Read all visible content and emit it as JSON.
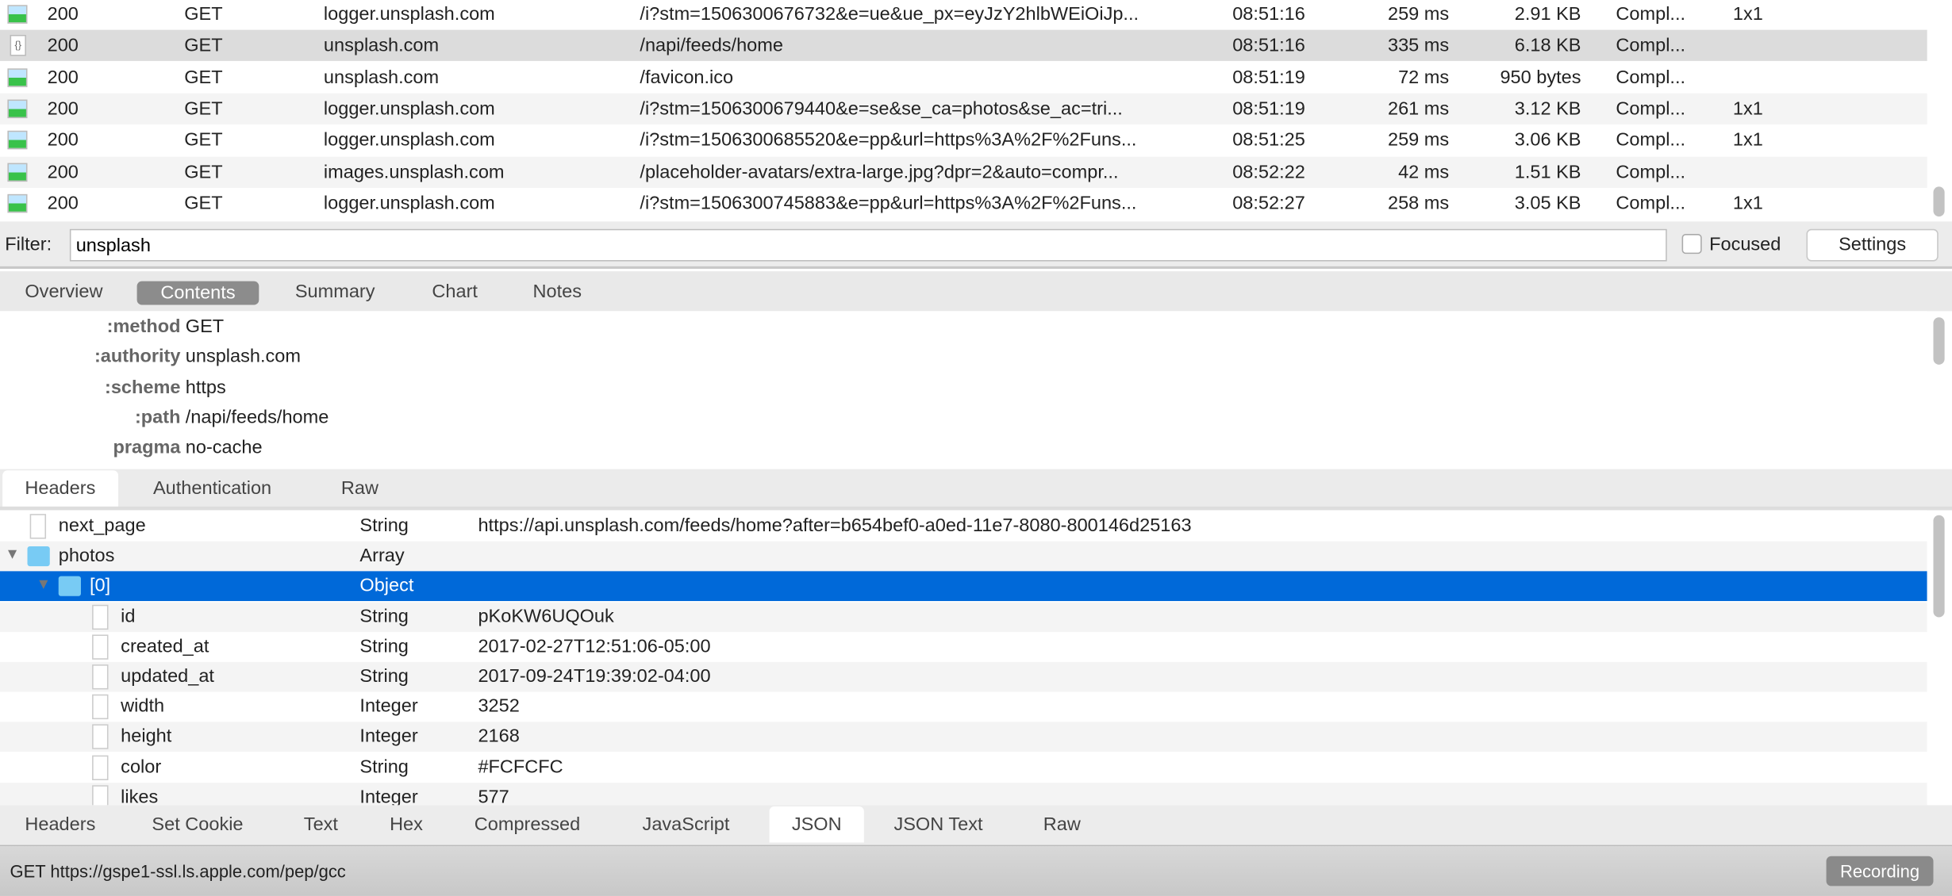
{
  "requests": {
    "selected_index": 1,
    "rows": [
      {
        "icon": "image-icon",
        "code": "200",
        "method": "GET",
        "host": "logger.unsplash.com",
        "path": "/i?stm=1506300676732&e=ue&ue_px=eyJzY2hlbWEiOiJp...",
        "time": "08:51:16",
        "duration": "259 ms",
        "size": "2.91 KB",
        "status": "Compl...",
        "dims": "1x1"
      },
      {
        "icon": "json-file-icon",
        "code": "200",
        "method": "GET",
        "host": "unsplash.com",
        "path": "/napi/feeds/home",
        "time": "08:51:16",
        "duration": "335 ms",
        "size": "6.18 KB",
        "status": "Compl...",
        "dims": ""
      },
      {
        "icon": "image-icon",
        "code": "200",
        "method": "GET",
        "host": "unsplash.com",
        "path": "/favicon.ico",
        "time": "08:51:19",
        "duration": "72 ms",
        "size": "950 bytes",
        "status": "Compl...",
        "dims": ""
      },
      {
        "icon": "image-icon",
        "code": "200",
        "method": "GET",
        "host": "logger.unsplash.com",
        "path": "/i?stm=1506300679440&e=se&se_ca=photos&se_ac=tri...",
        "time": "08:51:19",
        "duration": "261 ms",
        "size": "3.12 KB",
        "status": "Compl...",
        "dims": "1x1"
      },
      {
        "icon": "image-icon",
        "code": "200",
        "method": "GET",
        "host": "logger.unsplash.com",
        "path": "/i?stm=1506300685520&e=pp&url=https%3A%2F%2Funs...",
        "time": "08:51:25",
        "duration": "259 ms",
        "size": "3.06 KB",
        "status": "Compl...",
        "dims": "1x1"
      },
      {
        "icon": "image-icon",
        "code": "200",
        "method": "GET",
        "host": "images.unsplash.com",
        "path": "/placeholder-avatars/extra-large.jpg?dpr=2&auto=compr...",
        "time": "08:52:22",
        "duration": "42 ms",
        "size": "1.51 KB",
        "status": "Compl...",
        "dims": ""
      },
      {
        "icon": "image-icon",
        "code": "200",
        "method": "GET",
        "host": "logger.unsplash.com",
        "path": "/i?stm=1506300745883&e=pp&url=https%3A%2F%2Funs...",
        "time": "08:52:27",
        "duration": "258 ms",
        "size": "3.05 KB",
        "status": "Compl...",
        "dims": "1x1"
      }
    ]
  },
  "filter": {
    "label": "Filter:",
    "value": "unsplash",
    "focused_label": "Focused",
    "focused_checked": false,
    "settings_label": "Settings"
  },
  "main_tabs": {
    "active": "Contents",
    "items": [
      "Overview",
      "Contents",
      "Summary",
      "Chart",
      "Notes"
    ]
  },
  "request_headers": [
    {
      "key": ":method",
      "value": "GET"
    },
    {
      "key": ":authority",
      "value": "unsplash.com"
    },
    {
      "key": ":scheme",
      "value": "https"
    },
    {
      "key": ":path",
      "value": "/napi/feeds/home"
    },
    {
      "key": "pragma",
      "value": "no-cache"
    }
  ],
  "request_tabs": {
    "active": "Headers",
    "items": [
      "Headers",
      "Authentication",
      "Raw"
    ]
  },
  "json_tree": [
    {
      "depth": 0,
      "kind": "file",
      "expanded": null,
      "name": "next_page",
      "type": "String",
      "value": "https://api.unsplash.com/feeds/home?after=b654bef0-a0ed-11e7-8080-800146d25163"
    },
    {
      "depth": 0,
      "kind": "folder",
      "expanded": true,
      "name": "photos",
      "type": "Array",
      "value": ""
    },
    {
      "depth": 1,
      "kind": "folder",
      "expanded": true,
      "name": "[0]",
      "type": "Object",
      "value": "",
      "selected": true
    },
    {
      "depth": 2,
      "kind": "file",
      "expanded": null,
      "name": "id",
      "type": "String",
      "value": "pKoKW6UQOuk"
    },
    {
      "depth": 2,
      "kind": "file",
      "expanded": null,
      "name": "created_at",
      "type": "String",
      "value": "2017-02-27T12:51:06-05:00"
    },
    {
      "depth": 2,
      "kind": "file",
      "expanded": null,
      "name": "updated_at",
      "type": "String",
      "value": "2017-09-24T19:39:02-04:00"
    },
    {
      "depth": 2,
      "kind": "file",
      "expanded": null,
      "name": "width",
      "type": "Integer",
      "value": "3252"
    },
    {
      "depth": 2,
      "kind": "file",
      "expanded": null,
      "name": "height",
      "type": "Integer",
      "value": "2168"
    },
    {
      "depth": 2,
      "kind": "file",
      "expanded": null,
      "name": "color",
      "type": "String",
      "value": "#FCFCFC"
    },
    {
      "depth": 2,
      "kind": "file",
      "expanded": null,
      "name": "likes",
      "type": "Integer",
      "value": "577"
    }
  ],
  "response_tabs": {
    "active": "JSON",
    "items": [
      "Headers",
      "Set Cookie",
      "Text",
      "Hex",
      "Compressed",
      "JavaScript",
      "JSON",
      "JSON Text",
      "Raw"
    ]
  },
  "status_bar": {
    "text": "GET https://gspe1-ssl.ls.apple.com/pep/gcc",
    "recording_label": "Recording"
  },
  "colors": {
    "selection": "#0069d9",
    "selected_row": "#dcdcdc",
    "alt_row": "#f4f4f4",
    "pill": "#8c8c8c"
  }
}
